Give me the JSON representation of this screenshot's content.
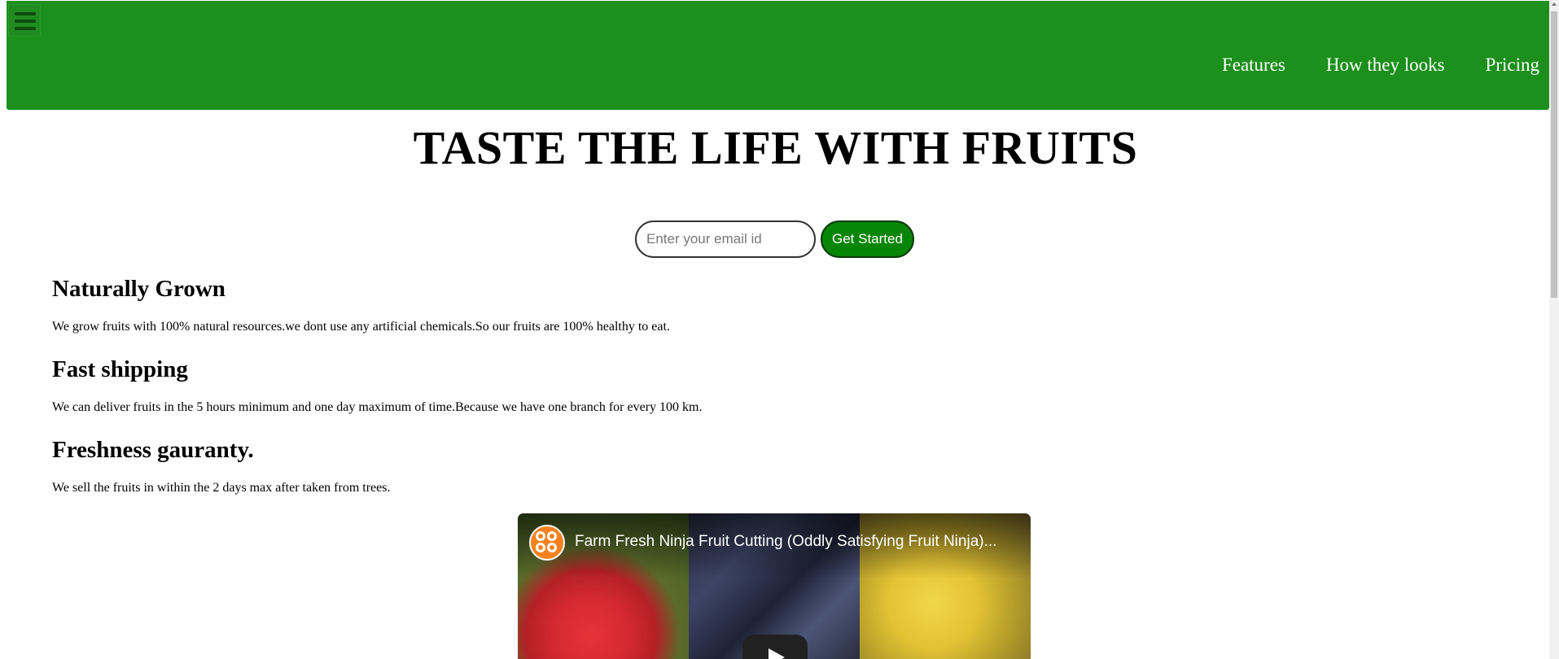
{
  "header": {
    "nav": [
      "Features",
      "How they looks",
      "Pricing"
    ]
  },
  "hero": {
    "title": "TASTE THE LIFE WITH FRUITS"
  },
  "signup": {
    "email_placeholder": "Enter your email id",
    "button_label": "Get Started"
  },
  "features": [
    {
      "heading": "Naturally Grown",
      "text": "We grow fruits with 100% natural resources.we dont use any artificial chemicals.So our fruits are 100% healthy to eat."
    },
    {
      "heading": "Fast shipping",
      "text": "We can deliver fruits in the 5 hours minimum and one day maximum of time.Because we have one branch for every 100 km."
    },
    {
      "heading": "Freshness gauranty.",
      "text": "We sell the fruits in within the 2 days max after taken from trees."
    }
  ],
  "video": {
    "title": "Farm Fresh Ninja Fruit Cutting (Oddly Satisfying Fruit Ninja)...",
    "channel_icon": "channel-logo-icon",
    "play_icon": "play-icon"
  },
  "colors": {
    "header_bg": "#1c8f1c",
    "button_bg": "#078507"
  }
}
